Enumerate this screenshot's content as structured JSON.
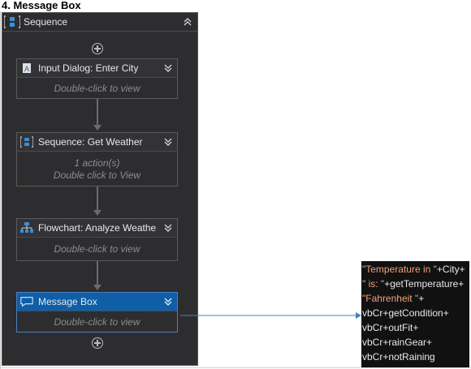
{
  "heading": "4. Message Box",
  "sequence": {
    "title": "Sequence"
  },
  "activities": [
    {
      "title": "Input Dialog: Enter City",
      "body": [
        "Double-click to view"
      ]
    },
    {
      "title": "Sequence: Get Weather",
      "body": [
        "1 action(s)",
        "Double click to View"
      ]
    },
    {
      "title": "Flowchart: Analyze Weathe",
      "body": [
        "Double-click to view"
      ]
    },
    {
      "title": "Message Box",
      "body": [
        "Double-click to view"
      ]
    }
  ],
  "code_lines": [
    {
      "str": "\"Temperature in \"",
      "rest": "+City+"
    },
    {
      "str": "\" is: \"",
      "rest": "+getTemperature+"
    },
    {
      "str": "\"Fahrenheit \"",
      "rest": "+"
    },
    {
      "str": "",
      "rest": "vbCr+getCondition+"
    },
    {
      "str": "",
      "rest": "vbCr+outFit+"
    },
    {
      "str": "",
      "rest": "vbCr+rainGear+"
    },
    {
      "str": "",
      "rest": "vbCr+notRaining"
    }
  ],
  "colors": {
    "panel": "#2d2d30",
    "selected_header": "#0e5fa8",
    "link_line": "#4a7fc1",
    "string_literal": "#f0a37a"
  },
  "icons": {
    "sequence": "sequence-icon",
    "collapse": "chevron-double-up-icon",
    "expand": "chevron-double-down-icon",
    "add": "plus-circle-icon",
    "input_dialog": "input-dialog-icon",
    "flowchart": "flowchart-icon",
    "message_box": "message-box-icon"
  }
}
